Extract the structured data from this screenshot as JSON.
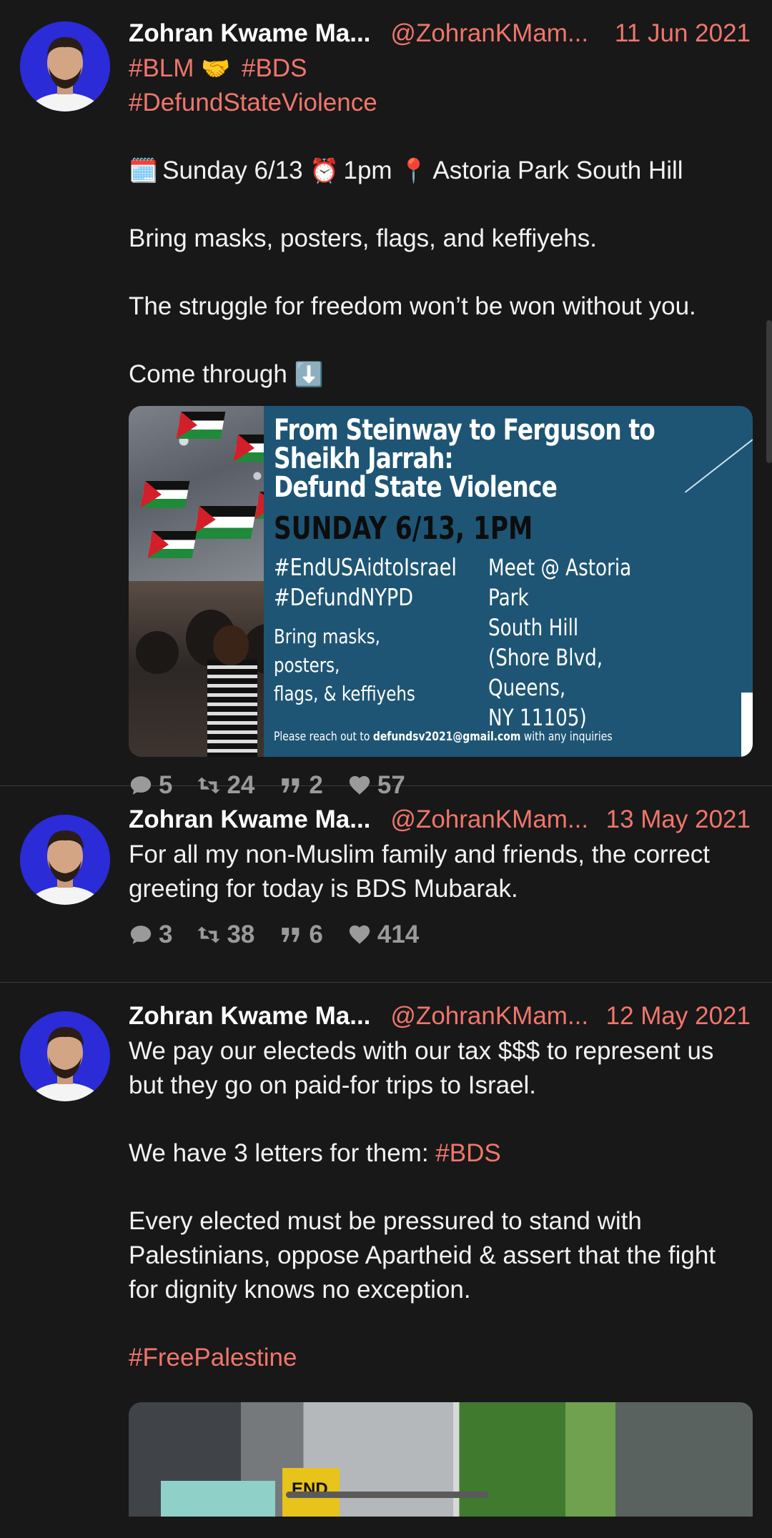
{
  "tweets": [
    {
      "author": "Zohran Kwame Ma...",
      "handle": "@ZohranKMam...",
      "date": "11 Jun 2021",
      "line1_tags": [
        "#BLM",
        "🤝",
        "#BDS"
      ],
      "line2_tag": "#DefundStateViolence",
      "event": {
        "cal": "🗓️",
        "day": "Sunday 6/13",
        "clock": "⏰",
        "time": "1pm",
        "pin": "📍",
        "place": "Astoria Park South Hill"
      },
      "p2": "Bring masks, posters, flags, and keffiyehs.",
      "p3": "The struggle for freedom won’t be won without you.",
      "p4_text": "Come through",
      "p4_emoji": "⬇️",
      "poster": {
        "title1": "From Steinway to Ferguson to",
        "title2": "Sheikh Jarrah:",
        "title3": "Defund State Violence",
        "when": "SUNDAY 6/13, 1PM",
        "tag1": "#EndUSAidtoIsrael",
        "tag2": "#DefundNYPD",
        "bring1": "Bring masks, posters,",
        "bring2": "flags, & keffiyehs",
        "meet1": "Meet @ Astoria Park",
        "meet2": "South Hill",
        "meet3": "(Shore Blvd, Queens,",
        "meet4": "NY 11105)",
        "foot_pre": "Please reach out to ",
        "foot_email": "defundsv2021@gmail.com",
        "foot_post": " with any inquiries"
      },
      "replies": "5",
      "retweets": "24",
      "quotes": "2",
      "likes": "57"
    },
    {
      "author": "Zohran Kwame Ma...",
      "handle": "@ZohranKMam...",
      "date": "13 May 2021",
      "p1": "For all my non-Muslim family and friends, the correct greeting for today is BDS Mubarak.",
      "replies": "3",
      "retweets": "38",
      "quotes": "6",
      "likes": "414"
    },
    {
      "author": "Zohran Kwame Ma...",
      "handle": "@ZohranKMam...",
      "date": "12 May 2021",
      "p1": "We pay our electeds with our tax $$$ to represent us but they go on paid-for trips to Israel.",
      "p2_text": "We have 3 letters for them: ",
      "p2_tag": "#BDS",
      "p3": "Every elected must be pressured to stand with Palestinians, oppose Apartheid & assert that the fight for dignity knows no exception.",
      "p4_tag": "#FreePalestine",
      "image_sign": "END"
    }
  ],
  "icons": {
    "reply": "speech-bubble-icon",
    "retweet": "retweet-icon",
    "quote": "quote-icon",
    "like": "heart-icon"
  },
  "colors": {
    "background": "#181818",
    "accent": "#f0766c",
    "muted": "#9a9a9a",
    "avatar_bg": "#2b2bd8",
    "poster_bg": "#1e5574"
  }
}
